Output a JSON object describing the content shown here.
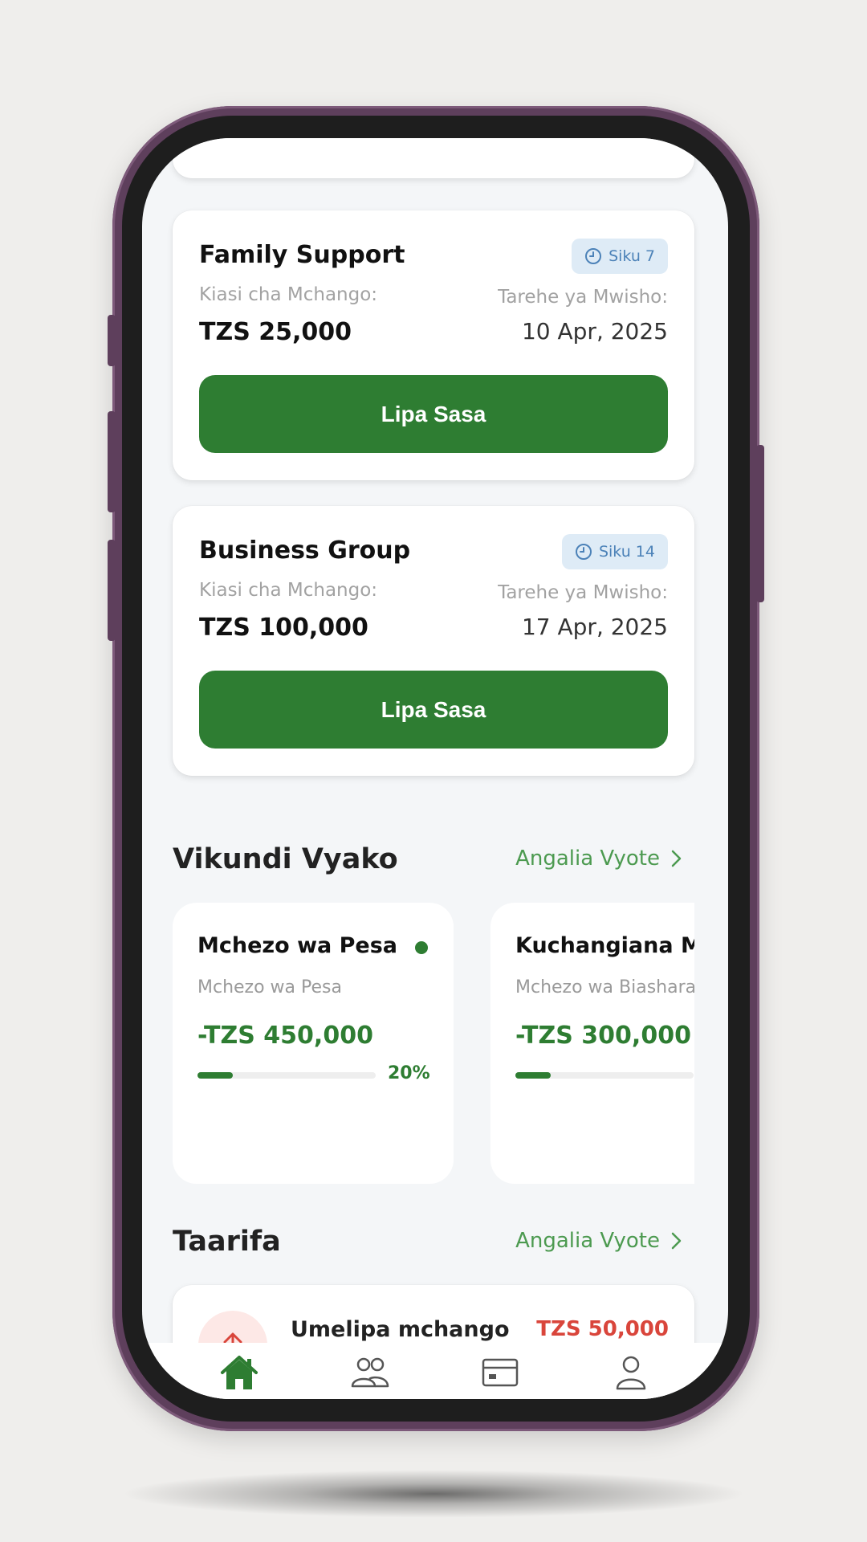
{
  "upcoming_payments": [
    {
      "title": "Family Support",
      "days_badge": "Siku 7",
      "amount_label": "Kiasi cha Mchango:",
      "amount": "TZS 25,000",
      "due_label": "Tarehe ya Mwisho:",
      "due_date": "10 Apr, 2025",
      "pay_button": "Lipa Sasa"
    },
    {
      "title": "Business Group",
      "days_badge": "Siku 14",
      "amount_label": "Kiasi cha Mchango:",
      "amount": "TZS 100,000",
      "due_label": "Tarehe ya Mwisho:",
      "due_date": "17 Apr, 2025",
      "pay_button": "Lipa Sasa"
    }
  ],
  "groups_section": {
    "title": "Vikundi Vyako",
    "see_all": "Angalia Vyote",
    "groups": [
      {
        "name": "Mchezo wa Pesa",
        "type": "Mchezo wa Pesa",
        "amount": "-TZS 450,000",
        "progress": 0.2,
        "progress_label": "20%",
        "active": true
      },
      {
        "name": "Kuchangiana Mta",
        "type": "Mchezo wa Biashara",
        "amount": "-TZS 300,000",
        "progress": 0.2
      }
    ]
  },
  "notifications_section": {
    "title": "Taarifa",
    "see_all": "Angalia Vyote",
    "items": [
      {
        "title": "Umelipa mchango",
        "amount": "TZS 50,000",
        "icon": "arrow-up-icon"
      }
    ]
  },
  "bottom_nav": [
    {
      "name": "home",
      "icon": "home-icon",
      "active": true
    },
    {
      "name": "groups",
      "icon": "groups-icon",
      "active": false
    },
    {
      "name": "payments",
      "icon": "card-icon",
      "active": false
    },
    {
      "name": "profile",
      "icon": "profile-icon",
      "active": false
    }
  ],
  "colors": {
    "primary": "#2e7d32",
    "badge_bg": "#deebf6",
    "badge_text": "#4c82b8",
    "debit": "#d9453b",
    "link": "#4c9a50",
    "phone_frame": "#5e3f5c"
  }
}
